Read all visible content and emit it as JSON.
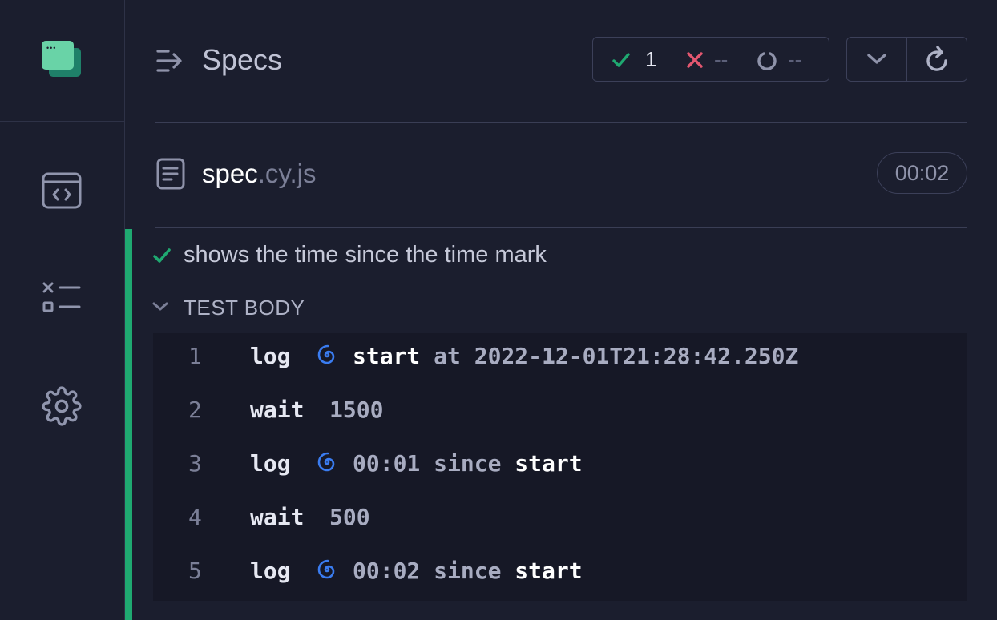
{
  "header": {
    "title": "Specs",
    "passed": "1",
    "failed": "--",
    "pending": "--"
  },
  "spec": {
    "name": "spec",
    "ext": ".cy.js",
    "duration": "00:02"
  },
  "test": {
    "title": "shows the time since the time mark",
    "section": "TEST BODY"
  },
  "commands": [
    {
      "num": "1",
      "name": "log",
      "emoji": "cyclone",
      "parts": [
        {
          "t": "start",
          "c": "w"
        },
        {
          "t": " at 2022-12-01T21:28:42.250Z",
          "c": "g"
        }
      ]
    },
    {
      "num": "2",
      "name": "wait",
      "message": "1500"
    },
    {
      "num": "3",
      "name": "log",
      "emoji": "cyclone",
      "parts": [
        {
          "t": "00:01 since ",
          "c": "g"
        },
        {
          "t": "start",
          "c": "w"
        }
      ]
    },
    {
      "num": "4",
      "name": "wait",
      "message": "500"
    },
    {
      "num": "5",
      "name": "log",
      "emoji": "cyclone",
      "parts": [
        {
          "t": "00:02 since ",
          "c": "g"
        },
        {
          "t": "start",
          "c": "w"
        }
      ]
    }
  ],
  "colors": {
    "pass": "#1fa971",
    "fail": "#e45770",
    "accent": "#69d3a7"
  },
  "icons": {
    "logo": "cypress-app-logo",
    "nav": [
      "specs-code-icon",
      "runs-list-icon",
      "settings-gear-icon"
    ],
    "cyclone": "cyclone-emoji"
  }
}
